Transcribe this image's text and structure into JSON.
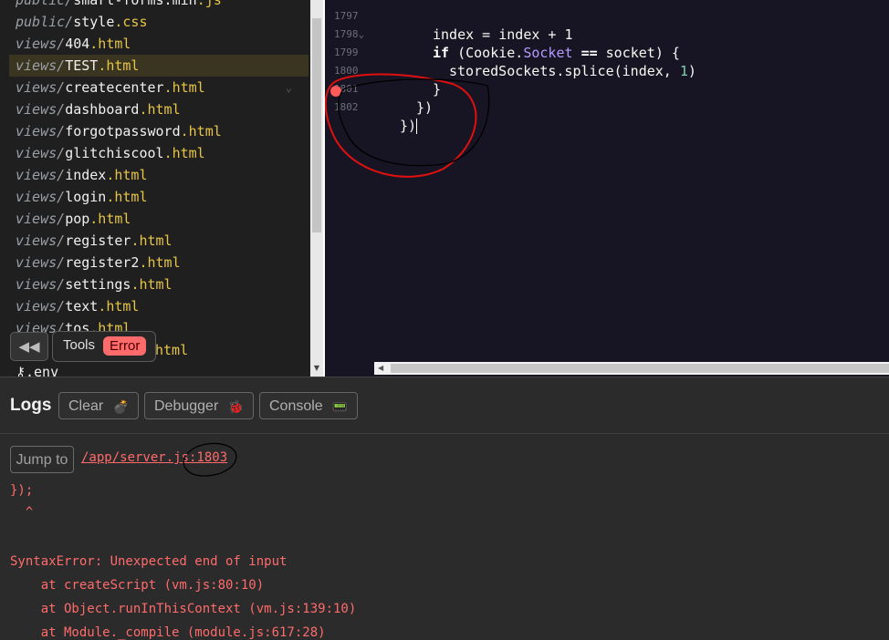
{
  "sidebar": {
    "files": [
      {
        "dir": "public/",
        "name": "smart-forms.min",
        "ext": ".js"
      },
      {
        "dir": "public/",
        "name": "style",
        "ext": ".css"
      },
      {
        "dir": "views/",
        "name": "404",
        "ext": ".html"
      },
      {
        "dir": "views/",
        "name": "TEST",
        "ext": ".html",
        "active": true
      },
      {
        "dir": "views/",
        "name": "createcenter",
        "ext": ".html"
      },
      {
        "dir": "views/",
        "name": "dashboard",
        "ext": ".html"
      },
      {
        "dir": "views/",
        "name": "forgotpassword",
        "ext": ".html"
      },
      {
        "dir": "views/",
        "name": "glitchiscool",
        "ext": ".html"
      },
      {
        "dir": "views/",
        "name": "index",
        "ext": ".html"
      },
      {
        "dir": "views/",
        "name": "login",
        "ext": ".html"
      },
      {
        "dir": "views/",
        "name": "pop",
        "ext": ".html"
      },
      {
        "dir": "views/",
        "name": "register",
        "ext": ".html"
      },
      {
        "dir": "views/",
        "name": "register2",
        "ext": ".html"
      },
      {
        "dir": "views/",
        "name": "settings",
        "ext": ".html"
      },
      {
        "dir": "views/",
        "name": "text",
        "ext": ".html"
      },
      {
        "dir": "views/",
        "name": "tos",
        "ext": ".html"
      },
      {
        "dir": "",
        "name": "",
        "ext": "html"
      },
      {
        "dir": "",
        "name": ".env",
        "ext": ""
      }
    ]
  },
  "tools": {
    "label": "Tools",
    "badge": "Error"
  },
  "editor": {
    "lines": [
      {
        "num": "1797",
        "text": "index = index + 1"
      },
      {
        "num": "1798",
        "fold": "⌄"
      },
      {
        "num": "1799",
        "text": "storedSockets.splice(index, 1)"
      },
      {
        "num": "1800",
        "text": "}"
      },
      {
        "num": "1801",
        "text": "})"
      },
      {
        "num": "1802",
        "text": "})"
      }
    ],
    "if_keyword": "if",
    "cookie": "(Cookie.",
    "socket_prop": "Socket",
    "eq_op": "==",
    "rest": "socket) {",
    "splice_pre": "storedSockets.splice(index, ",
    "splice_num": "1",
    "splice_post": ")"
  },
  "logs": {
    "title": "Logs",
    "buttons": [
      {
        "label": "Clear",
        "emoji": "💣"
      },
      {
        "label": "Debugger",
        "emoji": "🐞"
      },
      {
        "label": "Console",
        "emoji": "📟"
      }
    ],
    "jump_label": "Jump to",
    "jump_link": "/app/server.js:1803",
    "output": [
      "});",
      "  ^",
      "",
      "SyntaxError: Unexpected end of input",
      "    at createScript (vm.js:80:10)",
      "    at Object.runInThisContext (vm.js:139:10)",
      "    at Module._compile (module.js:617:28)"
    ]
  },
  "colors": {
    "accent_error": "#ff6b6b",
    "editor_bg": "#171523",
    "ext_yellow": "#e7c547"
  }
}
